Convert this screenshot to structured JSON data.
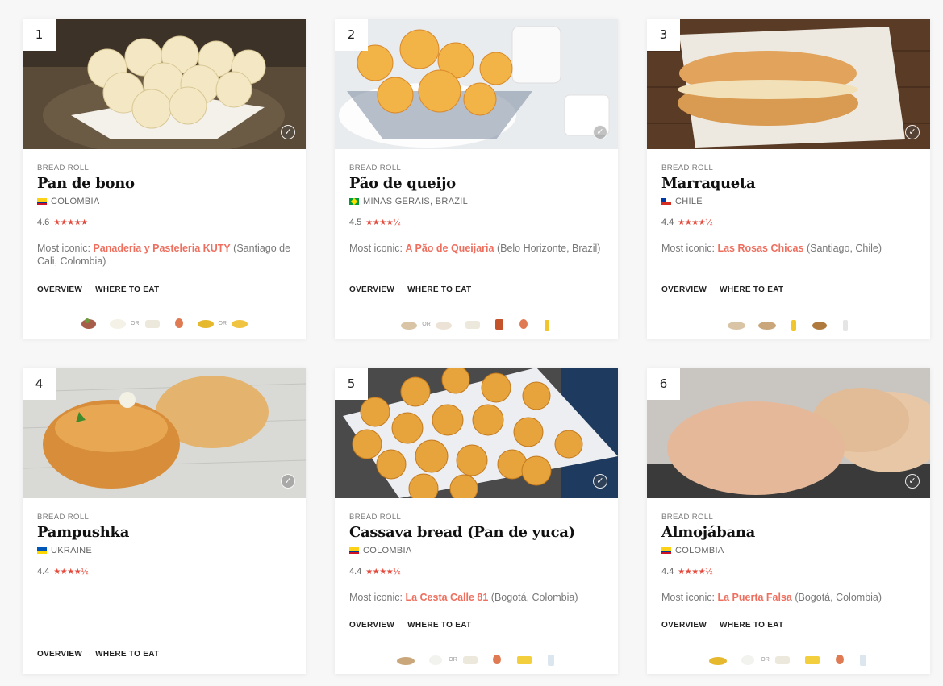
{
  "cards": [
    {
      "rank": "1",
      "category": "BREAD ROLL",
      "title": "Pan de bono",
      "origin": "COLOMBIA",
      "rating": "4.6",
      "stars": "★★★★★",
      "iconic_label": "Most iconic: ",
      "iconic_place": "Panaderia y Pasteleria KUTY",
      "iconic_loc": " (Santiago de Cali, Colombia)",
      "overview": "OVERVIEW",
      "where": "WHERE TO EAT",
      "or": [
        "OR",
        "OR"
      ],
      "flag_colors": [
        "#fcd116",
        "#003893",
        "#ce1126"
      ]
    },
    {
      "rank": "2",
      "category": "BREAD ROLL",
      "title": "Pão de queijo",
      "origin": "MINAS GERAIS, BRAZIL",
      "rating": "4.5",
      "stars": "★★★★½",
      "iconic_label": "Most iconic: ",
      "iconic_place": "A Pão de Queijaria",
      "iconic_loc": " (Belo Horizonte, Brazil)",
      "overview": "OVERVIEW",
      "where": "WHERE TO EAT",
      "or": [
        "OR"
      ],
      "flag_colors": [
        "#009c3b",
        "#ffdf00"
      ]
    },
    {
      "rank": "3",
      "category": "BREAD ROLL",
      "title": "Marraqueta",
      "origin": "CHILE",
      "rating": "4.4",
      "stars": "★★★★½",
      "iconic_label": "Most iconic: ",
      "iconic_place": "Las Rosas Chicas",
      "iconic_loc": " (Santiago, Chile)",
      "overview": "OVERVIEW",
      "where": "WHERE TO EAT",
      "flag_colors": [
        "#0039a6",
        "#ffffff",
        "#d52b1e"
      ]
    },
    {
      "rank": "4",
      "category": "BREAD ROLL",
      "title": "Pampushka",
      "origin": "UKRAINE",
      "rating": "4.4",
      "stars": "★★★★½",
      "overview": "OVERVIEW",
      "where": "WHERE TO EAT",
      "flag_colors": [
        "#0057b7",
        "#ffd700"
      ]
    },
    {
      "rank": "5",
      "category": "BREAD ROLL",
      "title": "Cassava bread (Pan de yuca)",
      "origin": "COLOMBIA",
      "rating": "4.4",
      "stars": "★★★★½",
      "iconic_label": "Most iconic: ",
      "iconic_place": "La Cesta Calle 81",
      "iconic_loc": " (Bogotá, Colombia)",
      "overview": "OVERVIEW",
      "where": "WHERE TO EAT",
      "or": [
        "OR"
      ],
      "flag_colors": [
        "#fcd116",
        "#003893",
        "#ce1126"
      ]
    },
    {
      "rank": "6",
      "category": "BREAD ROLL",
      "title": "Almojábana",
      "origin": "COLOMBIA",
      "rating": "4.4",
      "stars": "★★★★½",
      "iconic_label": "Most iconic: ",
      "iconic_place": "La Puerta Falsa",
      "iconic_loc": " (Bogotá, Colombia)",
      "overview": "OVERVIEW",
      "where": "WHERE TO EAT",
      "or": [
        "OR"
      ],
      "flag_colors": [
        "#fcd116",
        "#003893",
        "#ce1126"
      ]
    }
  ],
  "check_icon": "✓",
  "accent_color": "#ef6f5f",
  "star_color": "#e34a3c"
}
